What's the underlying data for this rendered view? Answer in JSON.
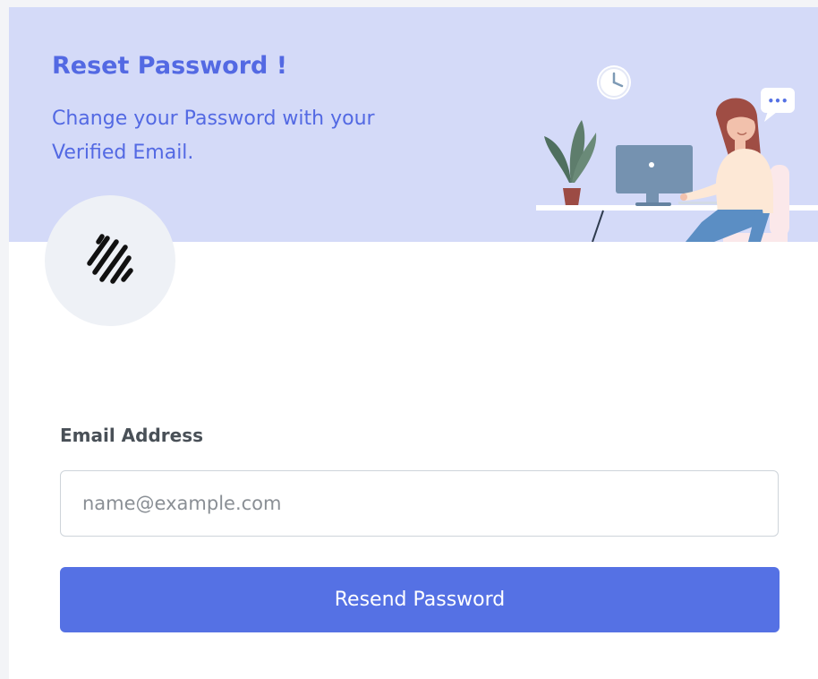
{
  "header": {
    "title": "Reset Password !",
    "subtitle": "Change your Password with your Verified Email."
  },
  "illustration": {
    "icon": "person-at-desk-illustration",
    "chat_bubble_text": "•••"
  },
  "logo": {
    "icon": "diagonal-lines-logo-icon"
  },
  "form": {
    "email_label": "Email Address",
    "email_placeholder": "name@example.com",
    "email_value": "",
    "submit_label": "Resend Password"
  },
  "colors": {
    "accent": "#5571e4",
    "banner_bg": "#d4daf8",
    "title_text": "#5369e3",
    "label_text": "#495057",
    "logo_circle_bg": "#eef1f6"
  }
}
